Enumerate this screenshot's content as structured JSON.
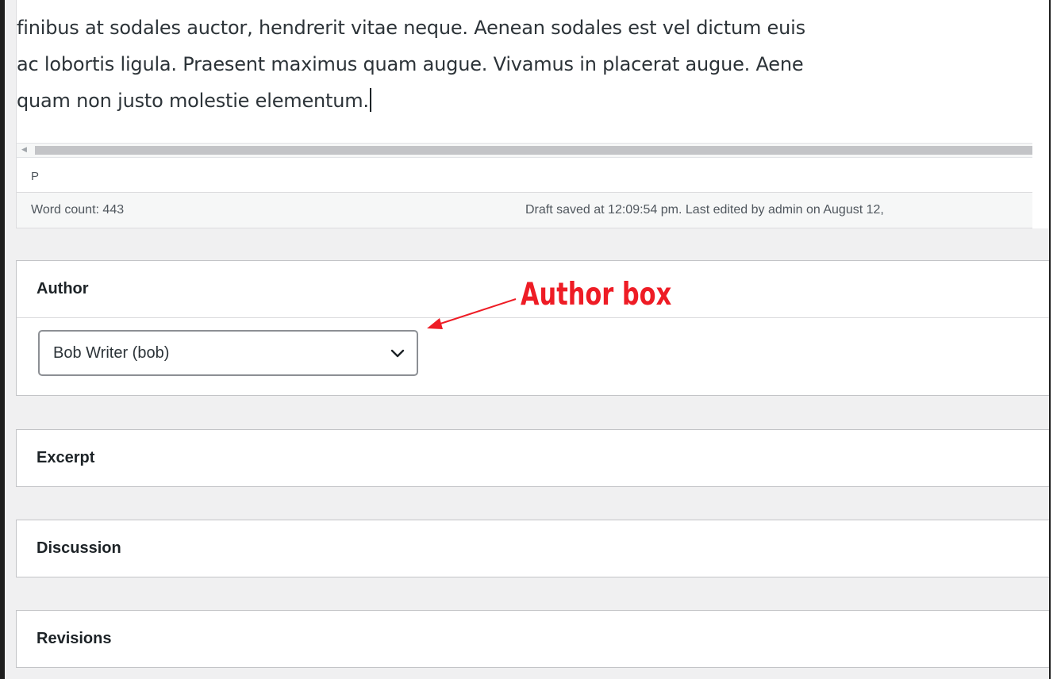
{
  "editor": {
    "lines": [
      "finibus at sodales auctor, hendrerit vitae neque. Aenean sodales est vel dictum euis",
      "ac lobortis ligula. Praesent maximus quam augue. Vivamus in placerat augue. Aene",
      "quam non justo molestie elementum."
    ],
    "path": "P",
    "word_count": "Word count: 443",
    "draft_status": "Draft saved at 12:09:54 pm. Last edited by admin on August 12,"
  },
  "author_box": {
    "title": "Author",
    "selected": "Bob Writer (bob)",
    "chevron_icon": "chevron-down-icon"
  },
  "excerpt_box": {
    "title": "Excerpt"
  },
  "discussion_box": {
    "title": "Discussion"
  },
  "revisions_box": {
    "title": "Revisions"
  },
  "annotation": {
    "label": "Author box",
    "color": "#ee1c25"
  }
}
